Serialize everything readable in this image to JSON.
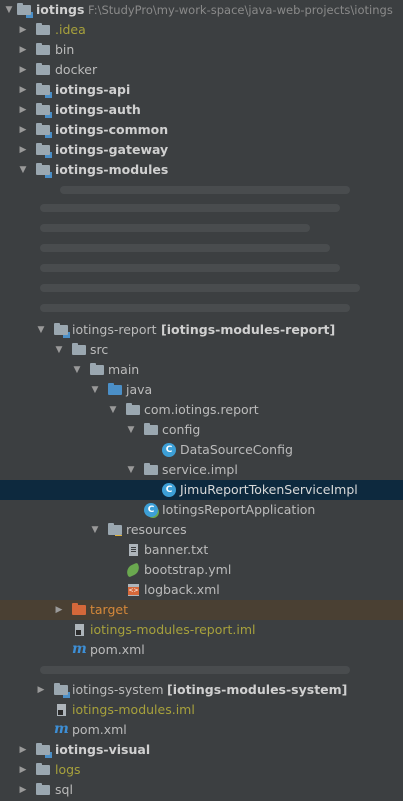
{
  "tree": {
    "root": {
      "label": "iotings",
      "path": "F:\\StudyPro\\my-work-space\\java-web-projects\\iotings"
    },
    "idea": ".idea",
    "bin": "bin",
    "docker": "docker",
    "api": "iotings-api",
    "auth": "iotings-auth",
    "common": "iotings-common",
    "gateway": "iotings-gateway",
    "modules": "iotings-modules",
    "report": {
      "name": "iotings-report",
      "module": "[iotings-modules-report]"
    },
    "src": "src",
    "main": "main",
    "java": "java",
    "package": "com.iotings.report",
    "config": "config",
    "datasource": "DataSourceConfig",
    "service_impl": "service.impl",
    "token_impl": "JimuReportTokenServiceImpl",
    "app": "IotingsReportApplication",
    "resources": "resources",
    "banner": "banner.txt",
    "bootstrap": "bootstrap.yml",
    "logback": "logback.xml",
    "target": "target",
    "report_iml": "iotings-modules-report.iml",
    "report_pom": "pom.xml",
    "system": {
      "name": "iotings-system",
      "module": "[iotings-modules-system]"
    },
    "modules_iml": "iotings-modules.iml",
    "modules_pom": "pom.xml",
    "visual": "iotings-visual",
    "logs": "logs",
    "sql": "sql"
  },
  "colors": {
    "background": "#3c3f41",
    "selection": "#0d293e",
    "excluded": "#4a4033",
    "ignored_text": "#a7a13c",
    "target_text": "#d5883a"
  }
}
